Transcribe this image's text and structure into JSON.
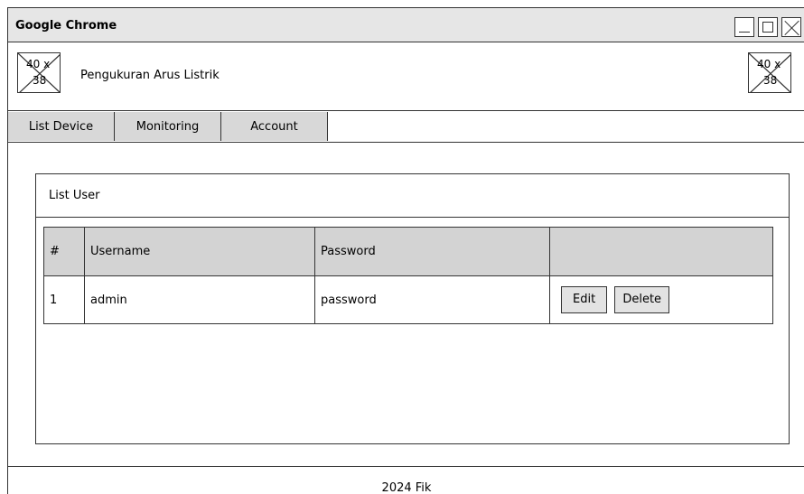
{
  "window": {
    "title": "Google Chrome"
  },
  "header": {
    "app_title": "Pengukuran Arus Listrik",
    "logo_left": {
      "top": "40 x",
      "bottom": "38"
    },
    "logo_right": {
      "top": "40 x",
      "bottom": "38"
    }
  },
  "nav": {
    "tabs": [
      {
        "label": "List Device"
      },
      {
        "label": "Monitoring"
      },
      {
        "label": "Account"
      }
    ]
  },
  "panel": {
    "title": "List User",
    "table": {
      "headers": [
        "#",
        "Username",
        "Password",
        ""
      ],
      "rows": [
        {
          "num": "1",
          "username": "admin",
          "password": "password"
        }
      ],
      "actions": {
        "edit": "Edit",
        "delete": "Delete"
      }
    }
  },
  "footer": {
    "text": "2024 Fik"
  },
  "colors": {
    "tab_bg": "#d8d8d8",
    "header_row_bg": "#d3d3d3",
    "button_bg": "#e3e3e3",
    "border": "#333333"
  }
}
